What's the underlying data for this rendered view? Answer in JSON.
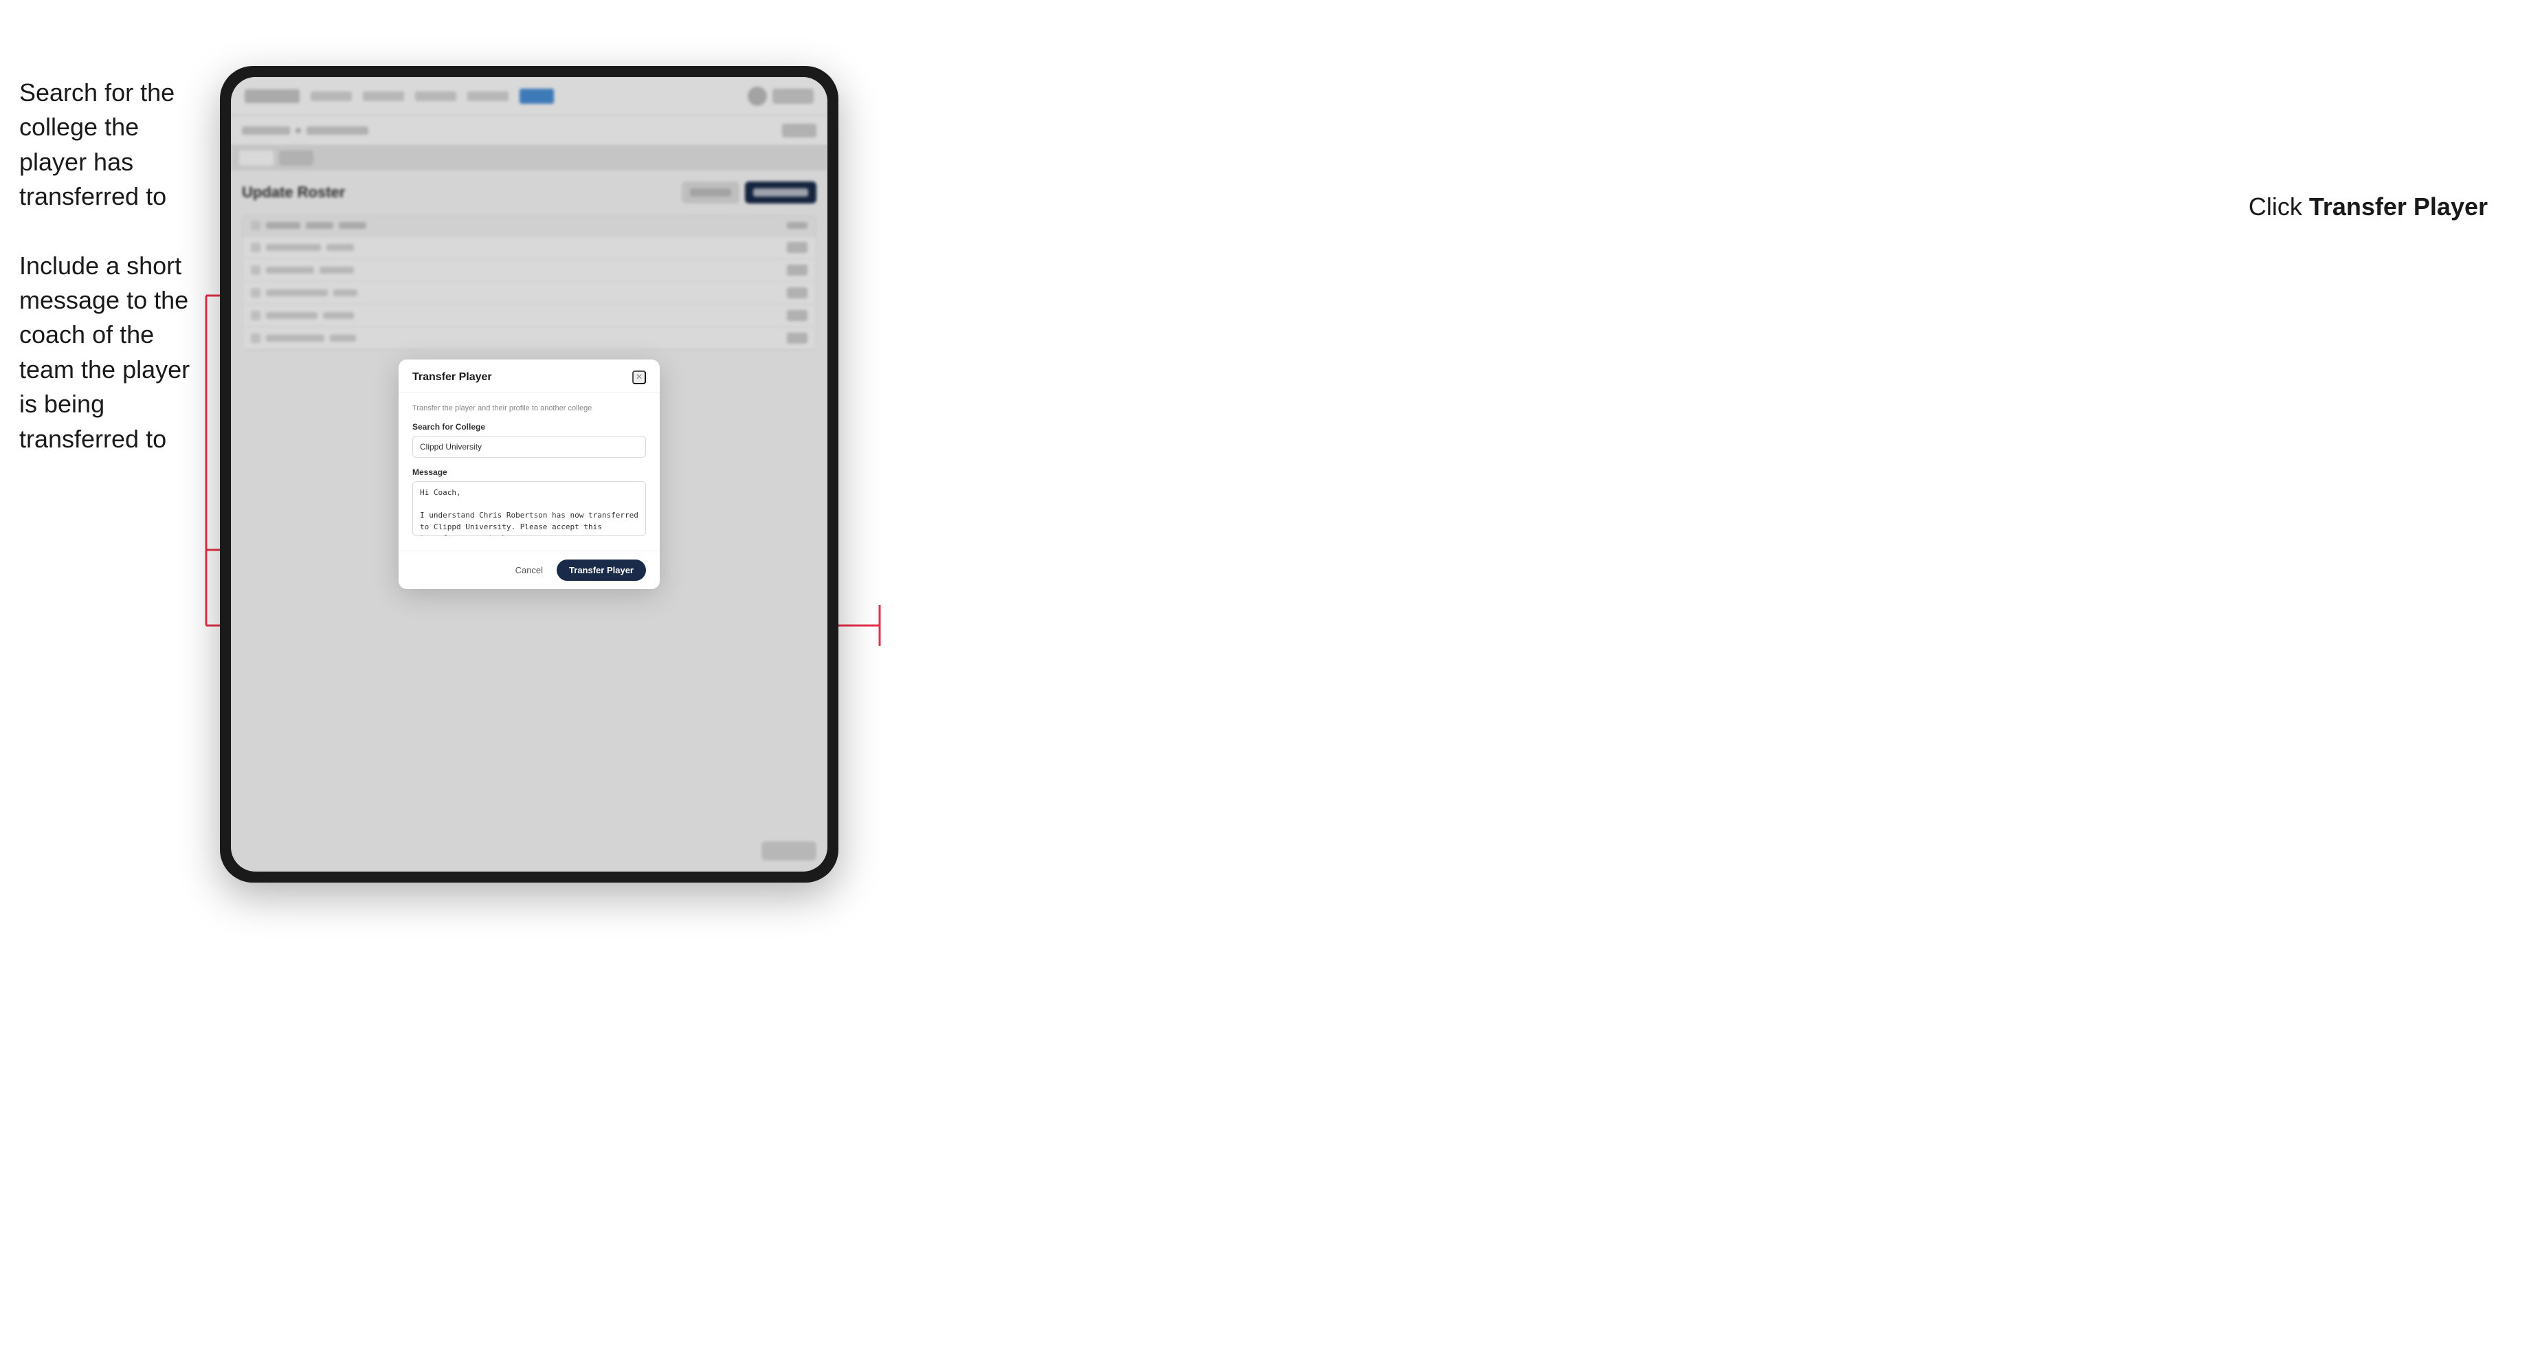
{
  "annotations": {
    "left_top": "Search for the college the player has transferred to",
    "left_bottom": "Include a short message to the coach of the team the player is being transferred to",
    "right": "Click Transfer Player"
  },
  "modal": {
    "title": "Transfer Player",
    "subtitle": "Transfer the player and their profile to another college",
    "search_label": "Search for College",
    "search_value": "Clippd University",
    "message_label": "Message",
    "message_value": "Hi Coach,\n\nI understand Chris Robertson has now transferred to Clippd University. Please accept this transfer request when you can.",
    "cancel_label": "Cancel",
    "transfer_label": "Transfer Player",
    "close_label": "×"
  },
  "app": {
    "page_title": "Update Roster"
  }
}
